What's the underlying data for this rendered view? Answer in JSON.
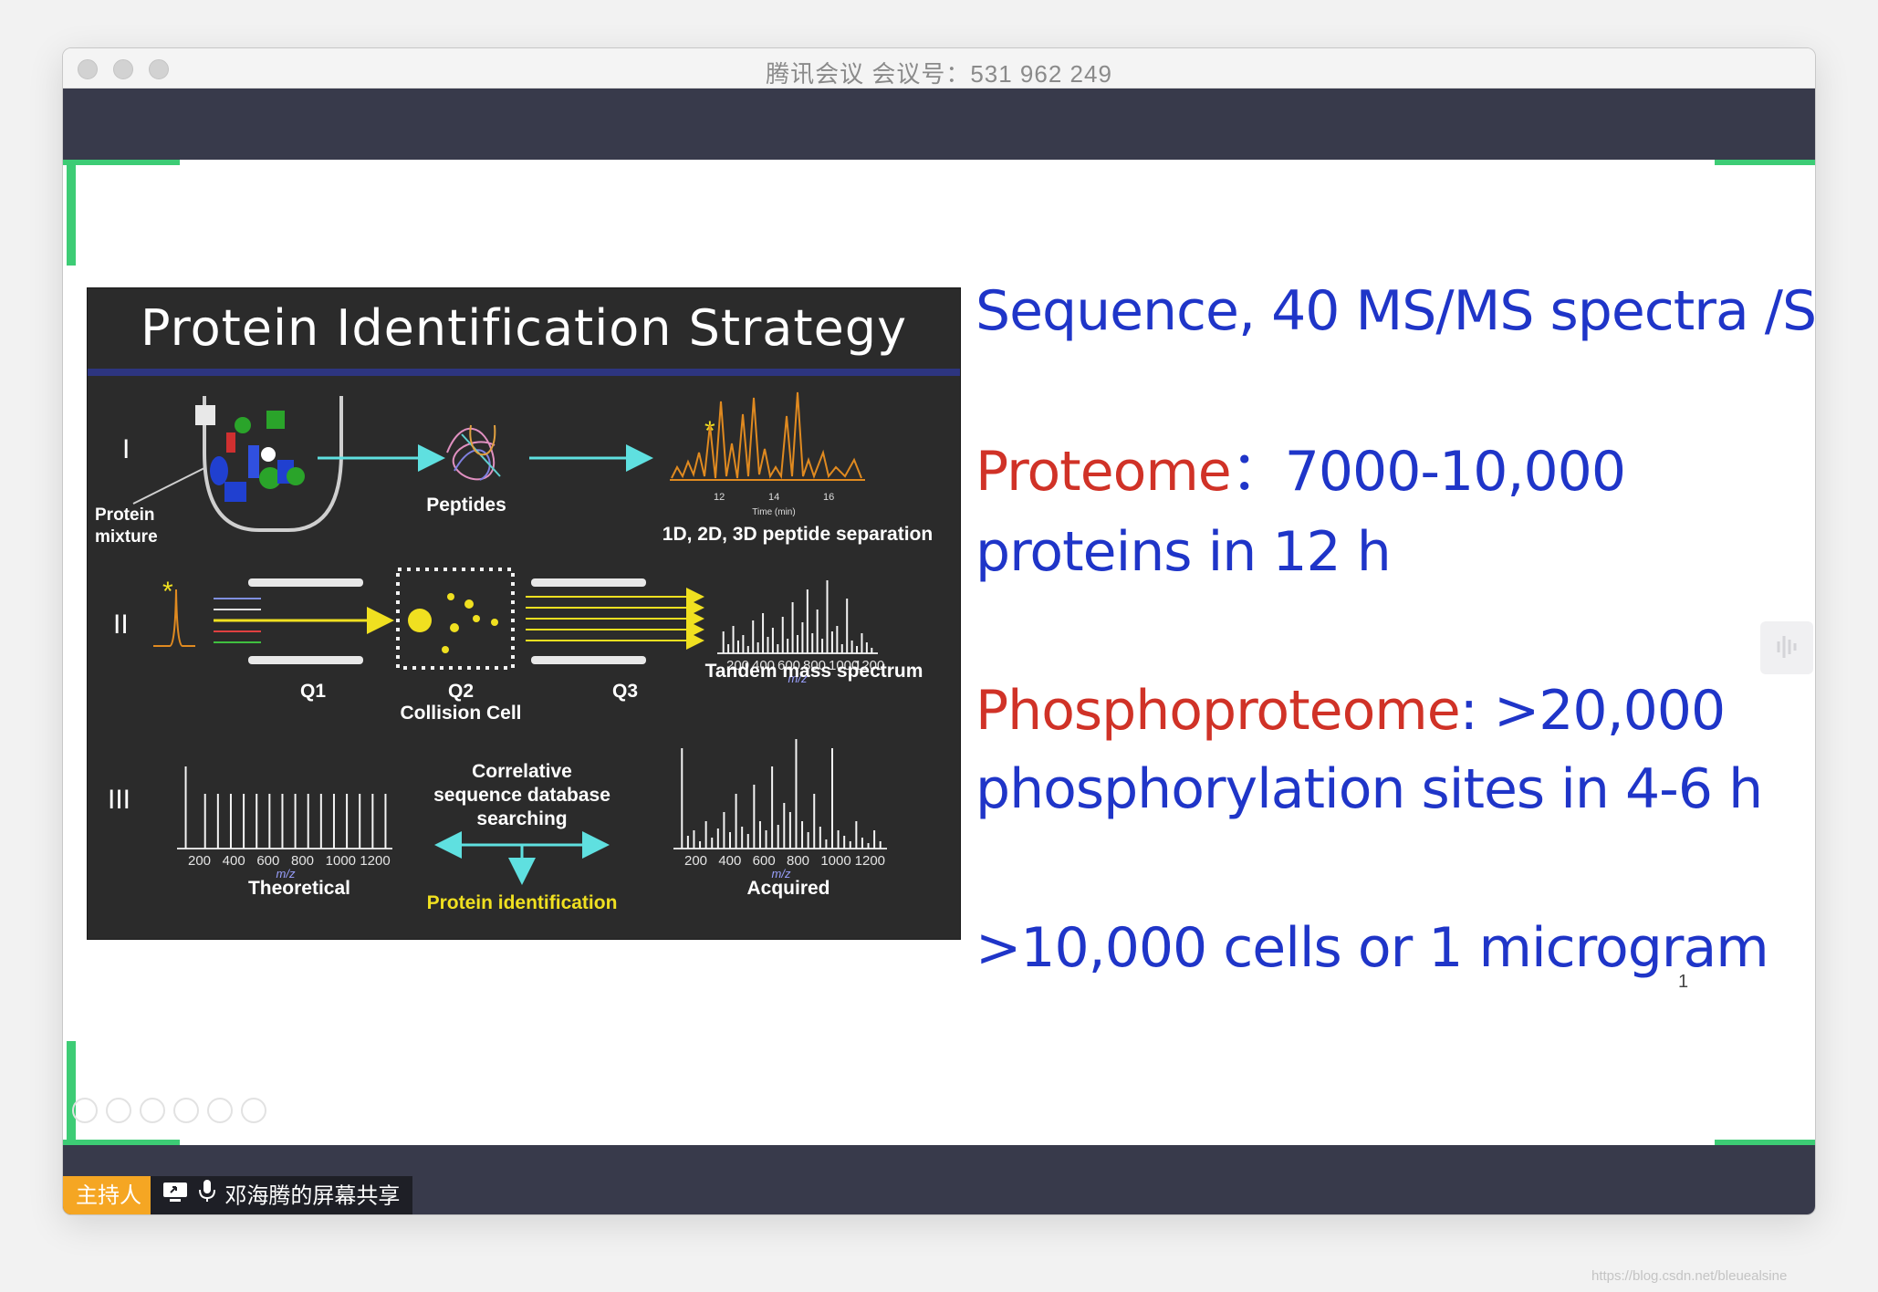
{
  "window": {
    "title": "腾讯会议 会议号：531 962 249"
  },
  "slide": {
    "figure": {
      "title": "Protein Identification Strategy",
      "rows": [
        "I",
        "II",
        "III"
      ],
      "protein_mixture": [
        "Protein",
        "mixture"
      ],
      "peptides": "Peptides",
      "separation": "1D, 2D, 3D peptide separation",
      "time_axis": "Time (min)",
      "time_ticks": [
        "12",
        "14",
        "16"
      ],
      "q1": "Q1",
      "q2": "Q2",
      "collision_cell": "Collision Cell",
      "q3": "Q3",
      "tandem": "Tandem mass spectrum",
      "mz_ticks": [
        "200",
        "400",
        "600",
        "800",
        "1000",
        "1200"
      ],
      "mz_label": "m/z",
      "correlative": [
        "Correlative",
        "sequence database",
        "searching"
      ],
      "protein_id": "Protein identification",
      "theoretical": "Theoretical",
      "acquired": "Acquired",
      "star": "*"
    },
    "line1": "Sequence, 40 MS/MS spectra /S",
    "proteome_label": "Proteome",
    "proteome_value": "：7000-10,000",
    "proteome_line2": "proteins in 12 h",
    "phospho_label": "Phosphoproteome",
    "phospho_value": ": >20,000",
    "phospho_line2": "phosphorylation sites in 4-6 h",
    "cells_line": ">10,000 cells or 1 microgram",
    "page_number": "1"
  },
  "bottom": {
    "host_label": "主持人",
    "share_label": "邓海腾的屏幕共享"
  },
  "watermark": "https://blog.csdn.net/bleuealsine",
  "colors": {
    "toolbar_bg": "#383a4b",
    "accent_green": "#3dcc75",
    "slide_blue": "#1f35c8",
    "slide_red": "#d03227",
    "host_orange": "#f5a623"
  },
  "icons": [
    "screen-share-icon",
    "microphone-icon",
    "live-icon",
    "prev-icon",
    "next-icon",
    "pen-icon",
    "copy-icon",
    "zoom-icon",
    "more-icon"
  ]
}
